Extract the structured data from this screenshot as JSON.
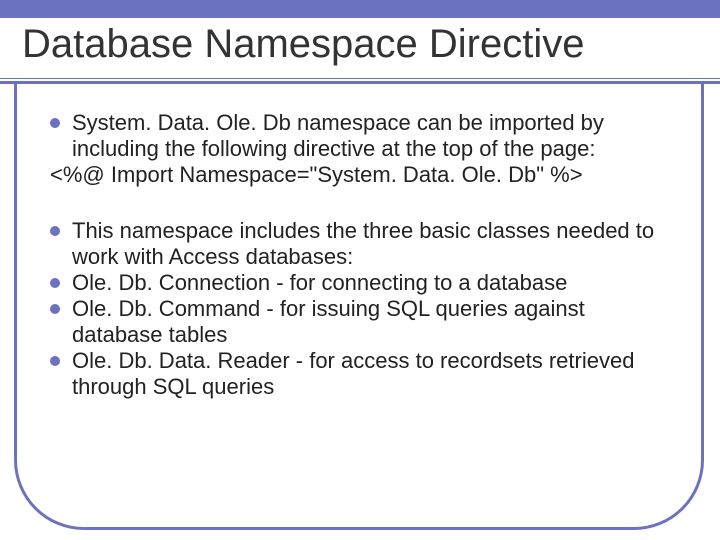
{
  "title": "Database Namespace Directive",
  "group1": {
    "bullet1": "System. Data. Ole. Db namespace can be imported by including the following directive at the top of the page:",
    "codeLine": "<%@ Import Namespace=\"System. Data. Ole. Db\" %>"
  },
  "group2": {
    "bullet1": "This namespace includes the three basic classes needed to work with Access databases:",
    "bullet2": "Ole. Db. Connection - for connecting to a database",
    "bullet3": "Ole. Db. Command - for issuing SQL queries against database tables",
    "bullet4": "Ole. Db. Data. Reader - for access to recordsets retrieved through SQL queries"
  }
}
